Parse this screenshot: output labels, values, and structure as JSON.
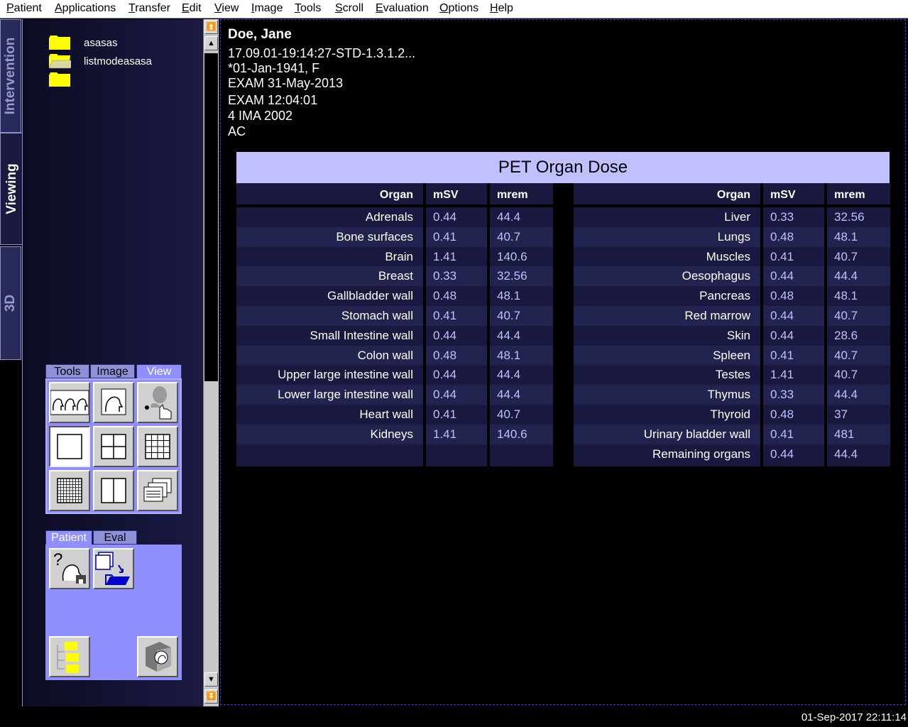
{
  "menu": [
    "Patient",
    "Applications",
    "Transfer",
    "Edit",
    "View",
    "Image",
    "Tools",
    "Scroll",
    "Evaluation",
    "Options",
    "Help"
  ],
  "side_tabs": [
    "Intervention",
    "Viewing",
    "3D"
  ],
  "folders": [
    "asasas",
    "listmodeasasa",
    ""
  ],
  "palette1": {
    "tabs": [
      "Tools",
      "Image",
      "View"
    ],
    "active": "View"
  },
  "palette2": {
    "tabs": [
      "Patient",
      "Eval"
    ],
    "active": "Patient"
  },
  "patient": {
    "name": "Doe, Jane",
    "study": "17.09.01-19:14:27-STD-1.3.1.2...",
    "birth": "*01-Jan-1941, F",
    "exam_date": "EXAM 31-May-2013",
    "exam_time": "EXAM 12:04:01",
    "image": "4 IMA 2002",
    "extra": "AC"
  },
  "dose": {
    "title": "PET Organ Dose",
    "headers": {
      "organ": "Organ",
      "msv": "mSV",
      "mrem": "mrem"
    },
    "left": [
      [
        "Adrenals",
        "0.44",
        "44.4"
      ],
      [
        "Bone surfaces",
        "0.41",
        "40.7"
      ],
      [
        "Brain",
        "1.41",
        "140.6"
      ],
      [
        "Breast",
        "0.33",
        "32.56"
      ],
      [
        "Gallbladder wall",
        "0.48",
        "48.1"
      ],
      [
        "Stomach wall",
        "0.41",
        "40.7"
      ],
      [
        "Small Intestine wall",
        "0.44",
        "44.4"
      ],
      [
        "Colon wall",
        "0.48",
        "48.1"
      ],
      [
        "Upper large intestine wall",
        "0.44",
        "44.4"
      ],
      [
        "Lower large intestine wall",
        "0.44",
        "44.4"
      ],
      [
        "Heart wall",
        "0.41",
        "40.7"
      ],
      [
        "Kidneys",
        "1.41",
        "140.6"
      ]
    ],
    "right": [
      [
        "Liver",
        "0.33",
        "32.56"
      ],
      [
        "Lungs",
        "0.48",
        "48.1"
      ],
      [
        "Muscles",
        "0.41",
        "40.7"
      ],
      [
        "Oesophagus",
        "0.44",
        "44.4"
      ],
      [
        "Pancreas",
        "0.48",
        "48.1"
      ],
      [
        "Red marrow",
        "0.44",
        "40.7"
      ],
      [
        "Skin",
        "0.44",
        "28.6"
      ],
      [
        "Spleen",
        "0.41",
        "40.7"
      ],
      [
        "Testes",
        "1.41",
        "40.7"
      ],
      [
        "Thymus",
        "0.33",
        "44.4"
      ],
      [
        "Thyroid",
        "0.48",
        "37"
      ],
      [
        "Urinary bladder wall",
        "0.41",
        "481"
      ],
      [
        "Remaining organs",
        "0.44",
        "44.4"
      ]
    ]
  },
  "clock": "01-Sep-2017 22:11:14",
  "colors": {
    "accent": "#8f8fff",
    "title_bg": "#c0c0ff",
    "cell_bg": "#191940",
    "value_text": "#c0c0ff"
  }
}
